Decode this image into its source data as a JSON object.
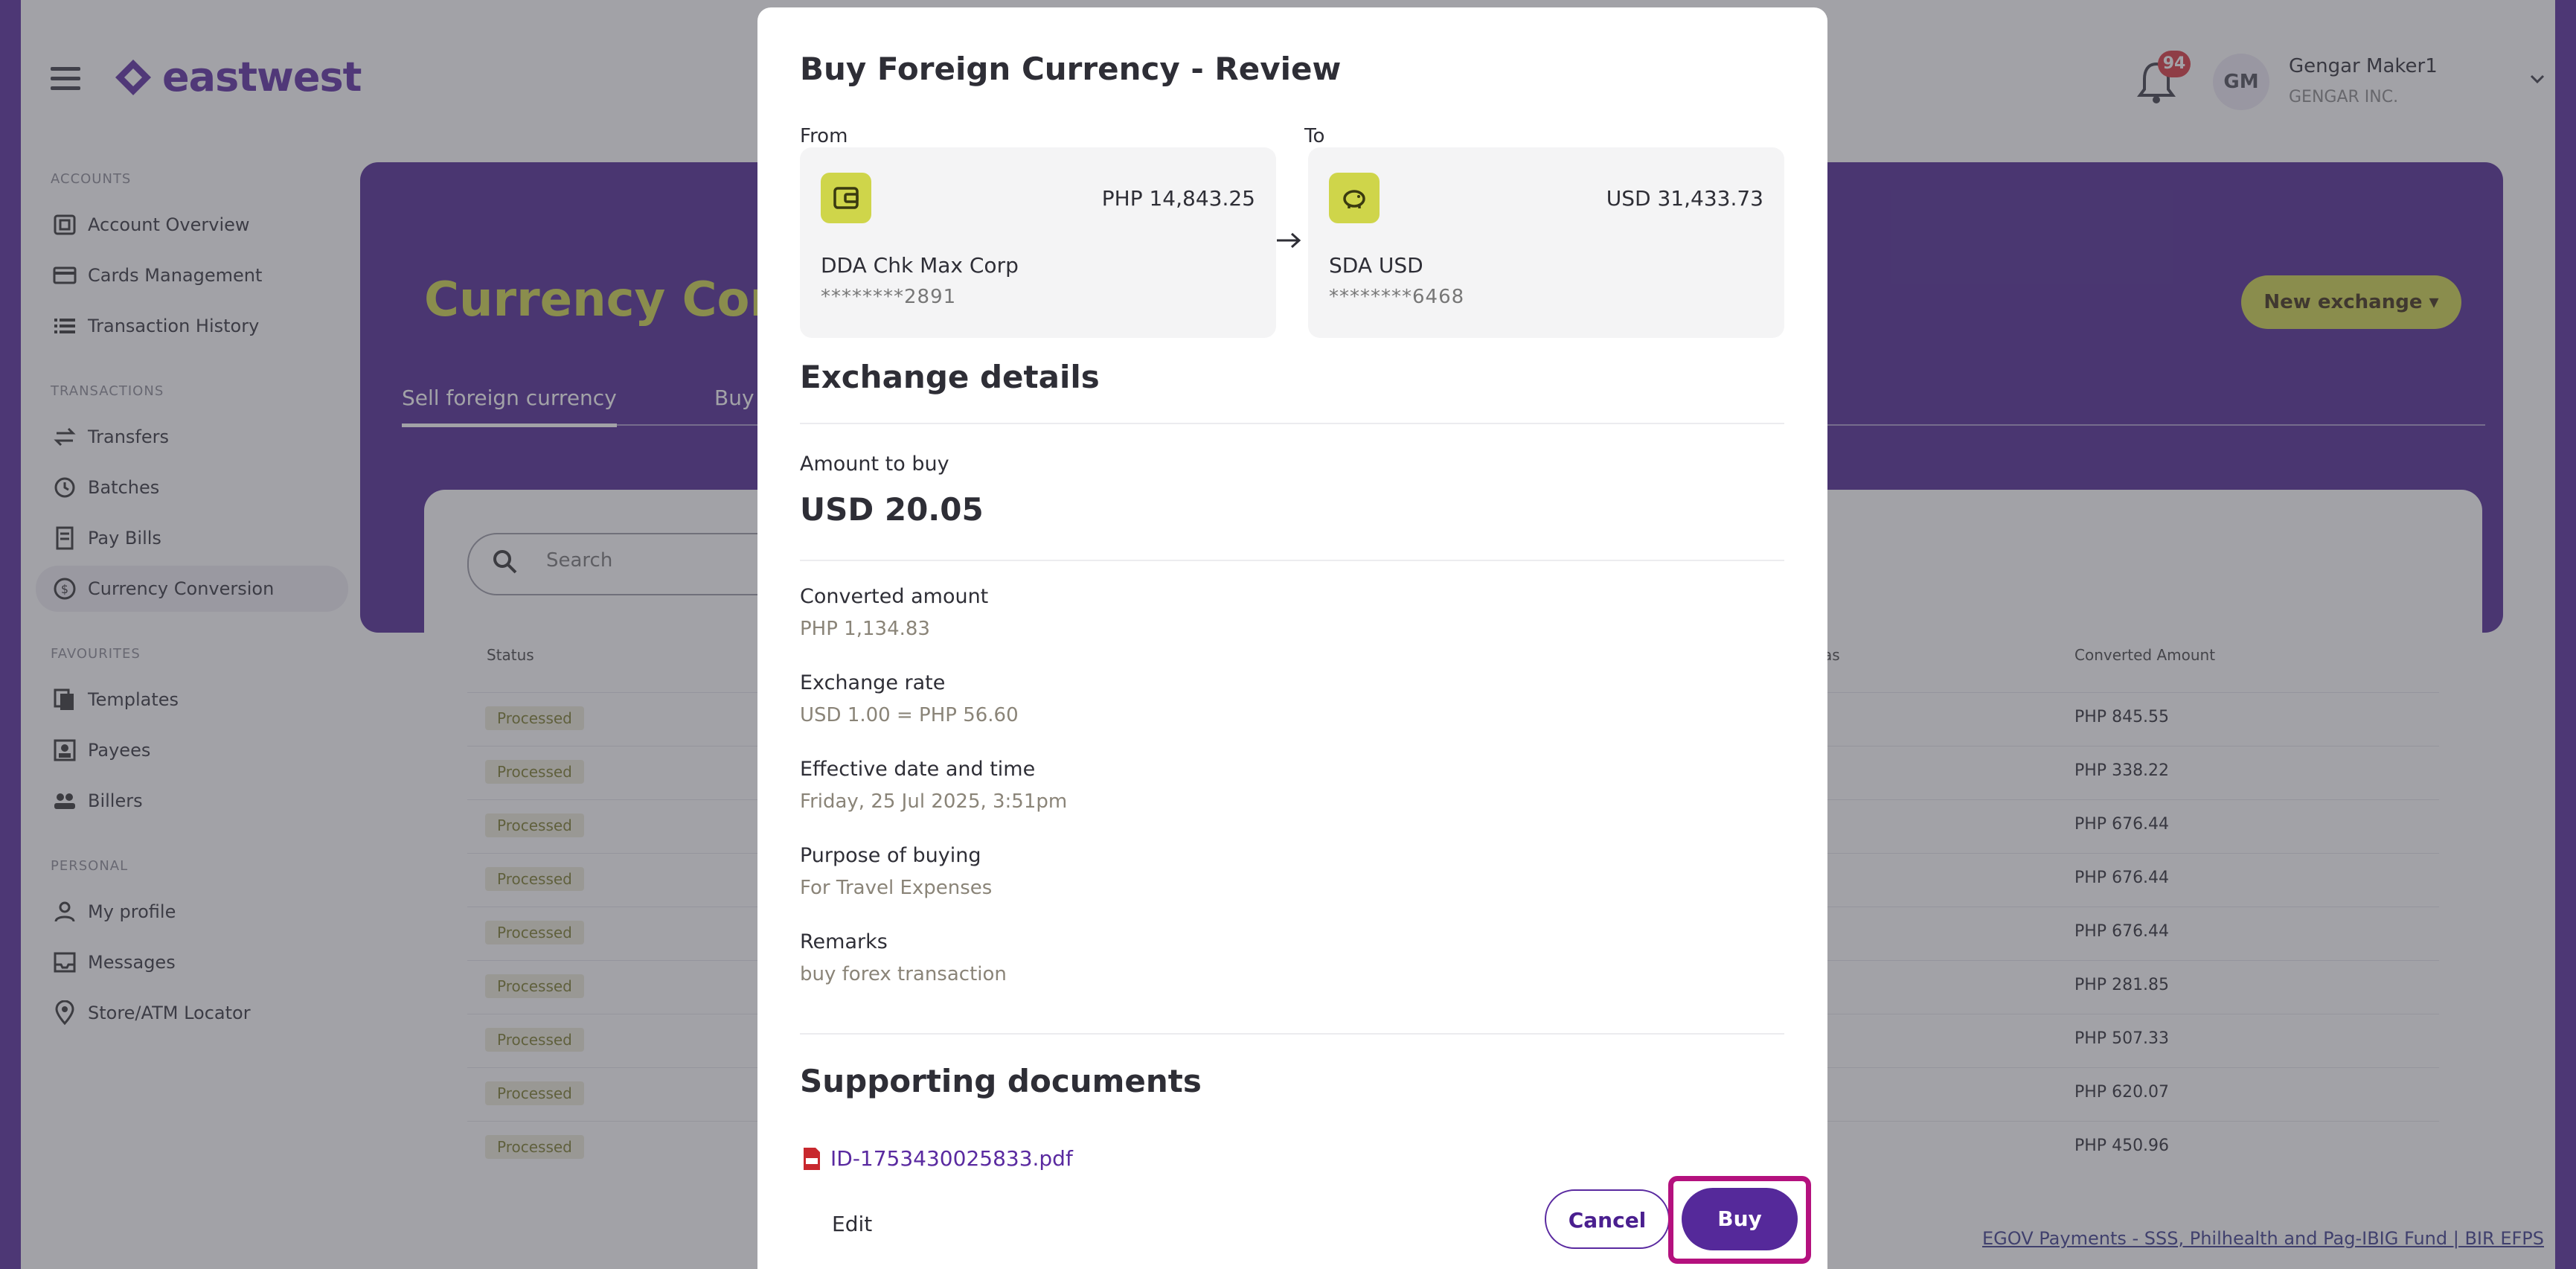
{
  "app": {
    "logo_text": "eastwest",
    "notifications_count": "94",
    "user": {
      "initials": "GM",
      "name": "Gengar Maker1",
      "org": "GENGAR INC."
    }
  },
  "sidebar": {
    "sections": [
      {
        "title": "ACCOUNTS",
        "items": [
          "Account Overview",
          "Cards Management",
          "Transaction History"
        ]
      },
      {
        "title": "TRANSACTIONS",
        "items": [
          "Transfers",
          "Batches",
          "Pay Bills",
          "Currency Conversion"
        ]
      },
      {
        "title": "FAVOURITES",
        "items": [
          "Templates",
          "Payees",
          "Billers"
        ]
      },
      {
        "title": "PERSONAL",
        "items": [
          "My profile",
          "Messages",
          "Store/ATM Locator"
        ]
      }
    ],
    "active_item": "Currency Conversion"
  },
  "page": {
    "title": "Currency Convers",
    "new_exchange_label": "New exchange ▾",
    "tabs": [
      "Sell foreign currency",
      "Buy"
    ],
    "search_placeholder": "Search",
    "table": {
      "columns": {
        "status": "Status",
        "as": "as",
        "converted": "Converted Amount"
      },
      "rows": [
        {
          "status": "Processed",
          "converted": "PHP 845.55"
        },
        {
          "status": "Processed",
          "converted": "PHP 338.22"
        },
        {
          "status": "Processed",
          "converted": "PHP 676.44"
        },
        {
          "status": "Processed",
          "converted": "PHP 676.44"
        },
        {
          "status": "Processed",
          "converted": "PHP 676.44"
        },
        {
          "status": "Processed",
          "converted": "PHP 281.85"
        },
        {
          "status": "Processed",
          "converted": "PHP 507.33"
        },
        {
          "status": "Processed",
          "converted": "PHP 620.07"
        },
        {
          "status": "Processed",
          "converted": "PHP 450.96"
        }
      ]
    },
    "footer_link": "EGOV Payments - SSS, Philhealth and Pag-IBIG Fund | BIR EFPS"
  },
  "modal": {
    "title": "Buy Foreign Currency - Review",
    "from_label": "From",
    "to_label": "To",
    "from_account": {
      "balance": "PHP 14,843.25",
      "name": "DDA Chk Max Corp",
      "number": "********2891"
    },
    "to_account": {
      "balance": "USD 31,433.73",
      "name": "SDA USD",
      "number": "********6468"
    },
    "exchange_heading": "Exchange details",
    "amount_label": "Amount to buy",
    "amount_value": "USD 20.05",
    "fields": [
      {
        "label": "Converted amount",
        "value": "PHP 1,134.83"
      },
      {
        "label": "Exchange rate",
        "value": "USD 1.00 = PHP 56.60"
      },
      {
        "label": "Effective date and time",
        "value": "Friday, 25 Jul 2025, 3:51pm"
      },
      {
        "label": "Purpose of buying",
        "value": "For Travel Expenses"
      },
      {
        "label": "Remarks",
        "value": "buy forex transaction"
      }
    ],
    "docs_heading": "Supporting documents",
    "document_name": "ID-1753430025833.pdf",
    "edit_label": "Edit",
    "cancel_label": "Cancel",
    "buy_label": "Buy"
  },
  "colors": {
    "brand_purple": "#55299a",
    "accent_lime": "#cfd54a",
    "highlight_magenta": "#b4117e"
  }
}
